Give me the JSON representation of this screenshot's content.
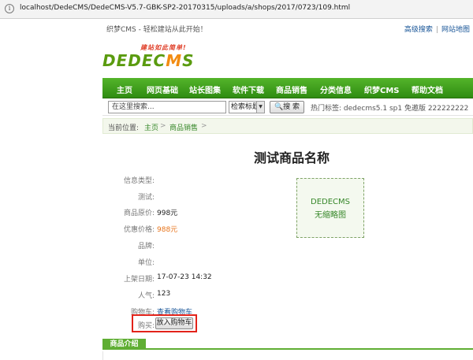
{
  "browser": {
    "url": "localhost/DedeCMS/DedeCMS-V5.7-GBK-SP2-20170315/uploads/a/shops/2017/0723/109.html"
  },
  "topstrip": {
    "welcome": "织梦CMS - 轻松建站从此开始！",
    "advanced_search": "高级搜索",
    "sitemap": "网站地图"
  },
  "logo": {
    "tagline": "建站如此简单!",
    "name_a": "DEDEC",
    "name_b": "M",
    "name_c": "S"
  },
  "nav": {
    "items": [
      "主页",
      "网页基础",
      "站长图集",
      "软件下载",
      "商品销售",
      "分类信息",
      "织梦CMS",
      "帮助文档"
    ]
  },
  "search": {
    "placeholder": "在这里搜索...",
    "select_value": "检索标题",
    "button": "搜 索",
    "hot": "热门标签: dedecms5.1 sp1 免邀版 222222222"
  },
  "breadcrumb": {
    "label": "当前位置:",
    "home": "主页",
    "sep1": ">",
    "section": "商品销售",
    "sep2": ">"
  },
  "product": {
    "title": "测试商品名称",
    "fields": [
      {
        "label": "信息类型:",
        "value": ""
      },
      {
        "label": "测试:",
        "value": ""
      },
      {
        "label": "商品原价:",
        "value": "998元"
      },
      {
        "label": "优惠价格:",
        "value": "988元"
      },
      {
        "label": "品牌:",
        "value": ""
      },
      {
        "label": "单位:",
        "value": ""
      },
      {
        "label": "上架日期:",
        "value": "17-07-23 14:32"
      },
      {
        "label": "人气:",
        "value": "123"
      },
      {
        "label": "购物车:",
        "value": "查看购物车"
      }
    ],
    "buy_label": "购买:",
    "buy_button": "放入购物车",
    "thumb_line1": "DEDECMS",
    "thumb_line2": "无缩略图"
  },
  "tabs": {
    "intro": "商品介绍"
  },
  "colors": {
    "nav_green": "#3a9a1a",
    "price_orange": "#e7731a",
    "link_blue": "#175497",
    "highlight_red": "#e2231a"
  }
}
